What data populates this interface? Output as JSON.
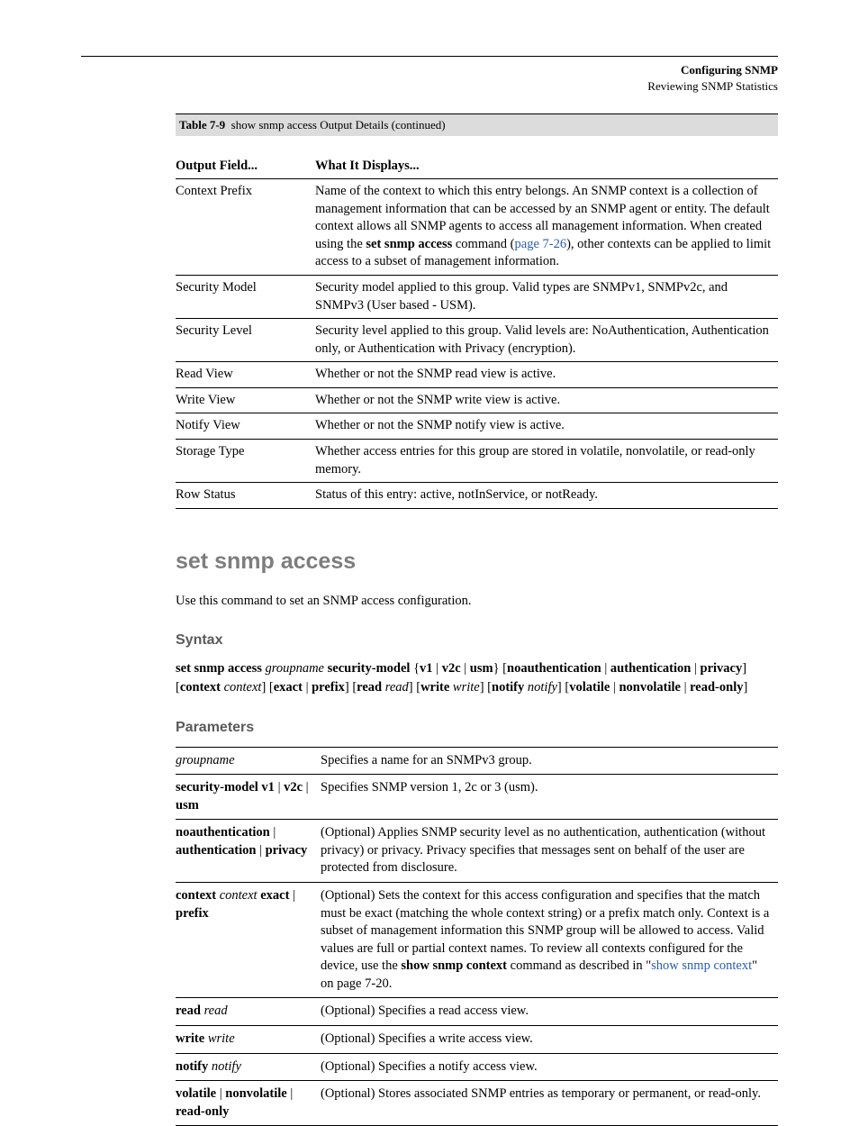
{
  "header": {
    "crumb1": "Configuring SNMP",
    "crumb2": "Reviewing SNMP Statistics"
  },
  "first_table": {
    "title_prefix": "Table 7-9",
    "title_rest": "show snmp access Output Details (continued)",
    "head": {
      "c1": "Output Field...",
      "c2": "What It Displays..."
    },
    "rows": [
      {
        "c1": "Context Prefix",
        "c2_a": "Name of the context to which this entry belongs. An SNMP context is a collection of management information that can be accessed by an SNMP agent or entity. The default context allows all SNMP agents to access all management information. When created using the ",
        "c2_bold": "set snmp access",
        "c2_b": " command (",
        "c2_link": "page 7-26",
        "c2_c": "), other contexts can be applied to limit access to a subset of management information."
      },
      {
        "c1": "Security Model",
        "c2": "Security model applied to this group. Valid types are SNMPv1, SNMPv2c, and SNMPv3 (User based - USM)."
      },
      {
        "c1": "Security Level",
        "c2": "Security level applied to this group. Valid levels are: NoAuthentication, Authentication only, or Authentication with Privacy (encryption)."
      },
      {
        "c1": "Read View",
        "c2": "Whether or not the SNMP read view is active."
      },
      {
        "c1": "Write View",
        "c2": "Whether or not the SNMP write view is active."
      },
      {
        "c1": "Notify View",
        "c2": "Whether or not the SNMP notify view is active."
      },
      {
        "c1": "Storage Type",
        "c2": "Whether access entries for this group are stored in volatile, nonvolatile, or read-only memory."
      },
      {
        "c1": "Row Status",
        "c2": "Status of this entry: active, notInService, or notReady."
      }
    ]
  },
  "cmd": {
    "title": "set snmp access",
    "desc": "Use this command to set an SNMP access configuration.",
    "syntax_title": "Syntax",
    "syntax_parts": {
      "p1": "set snmp access ",
      "p2": "groupname ",
      "p3": "security-model ",
      "p4": "{",
      "p5": "v1",
      "p6": " | ",
      "p7": "v2c",
      "p8": " | ",
      "p9": "usm",
      "p10": "} ",
      "p11": "[",
      "p12": "noauthentication",
      "p13": " | ",
      "p14": "authentication",
      "p15": " | ",
      "p16": "privacy",
      "p17": "] [",
      "p18": "context ",
      "p19": "context",
      "p20": "] [",
      "p21": "exact",
      "p22": " | ",
      "p23": "prefix",
      "p24": "] [",
      "p25": "read ",
      "p26": "read",
      "p27": "] [",
      "p28": "write ",
      "p29": "write",
      "p30": "] [",
      "p31": "notify ",
      "p32": "notify",
      "p33": "] [",
      "p34": "volatile",
      "p35": " | ",
      "p36": "nonvolatile",
      "p37": " | ",
      "p38": "read-only",
      "p39": "]"
    },
    "params_title": "Parameters",
    "params": [
      {
        "name": {
          "i1": "groupname"
        },
        "desc": "Specifies a name for an SNMPv3 group."
      },
      {
        "name": {
          "b1": "security-model v1",
          "sep1": " | ",
          "b2": "v2c",
          "sep2": " | ",
          "b3": "usm"
        },
        "desc": "Specifies SNMP version 1, 2c or 3 (usm)."
      },
      {
        "name": {
          "b1": "noauthentication",
          "sep1": " | ",
          "b2": "authentication",
          "sep2": " | ",
          "b3": "privacy"
        },
        "desc": "(Optional) Applies SNMP security level as no authentication, authentication (without privacy) or privacy. Privacy specifies that messages sent on behalf of the user are protected from disclosure."
      },
      {
        "name": {
          "b1": "context",
          "sp": " ",
          "i1": "context",
          "sp2": " ",
          "b2": "exact",
          "sep1": " | ",
          "b3": "prefix"
        },
        "desc_a": "(Optional) Sets the context for this access configuration and specifies that the match must be exact (matching the whole context string) or a prefix match only. Context is a subset of management information this SNMP group will be allowed to access. Valid values are full or partial context names. To review all contexts configured for the device, use the ",
        "desc_b": "show snmp context",
        "desc_c": " command as described in \"",
        "desc_link": "show snmp context",
        "desc_d": "\" on page 7-20."
      },
      {
        "name": {
          "b1": "read",
          "sp": " ",
          "i1": "read"
        },
        "desc": "(Optional) Specifies a read access view."
      },
      {
        "name": {
          "b1": "write",
          "sp": " ",
          "i1": "write"
        },
        "desc": "(Optional) Specifies a write access view."
      },
      {
        "name": {
          "b1": "notify",
          "sp": " ",
          "i1": "notify"
        },
        "desc": "(Optional) Specifies a notify access view."
      },
      {
        "name": {
          "b1": "volatile",
          "sep1": " | ",
          "b2": "nonvolatile",
          "sep2": " | ",
          "b3": "read-only"
        },
        "desc": "(Optional) Stores associated SNMP entries as temporary or permanent, or read-only."
      }
    ]
  }
}
